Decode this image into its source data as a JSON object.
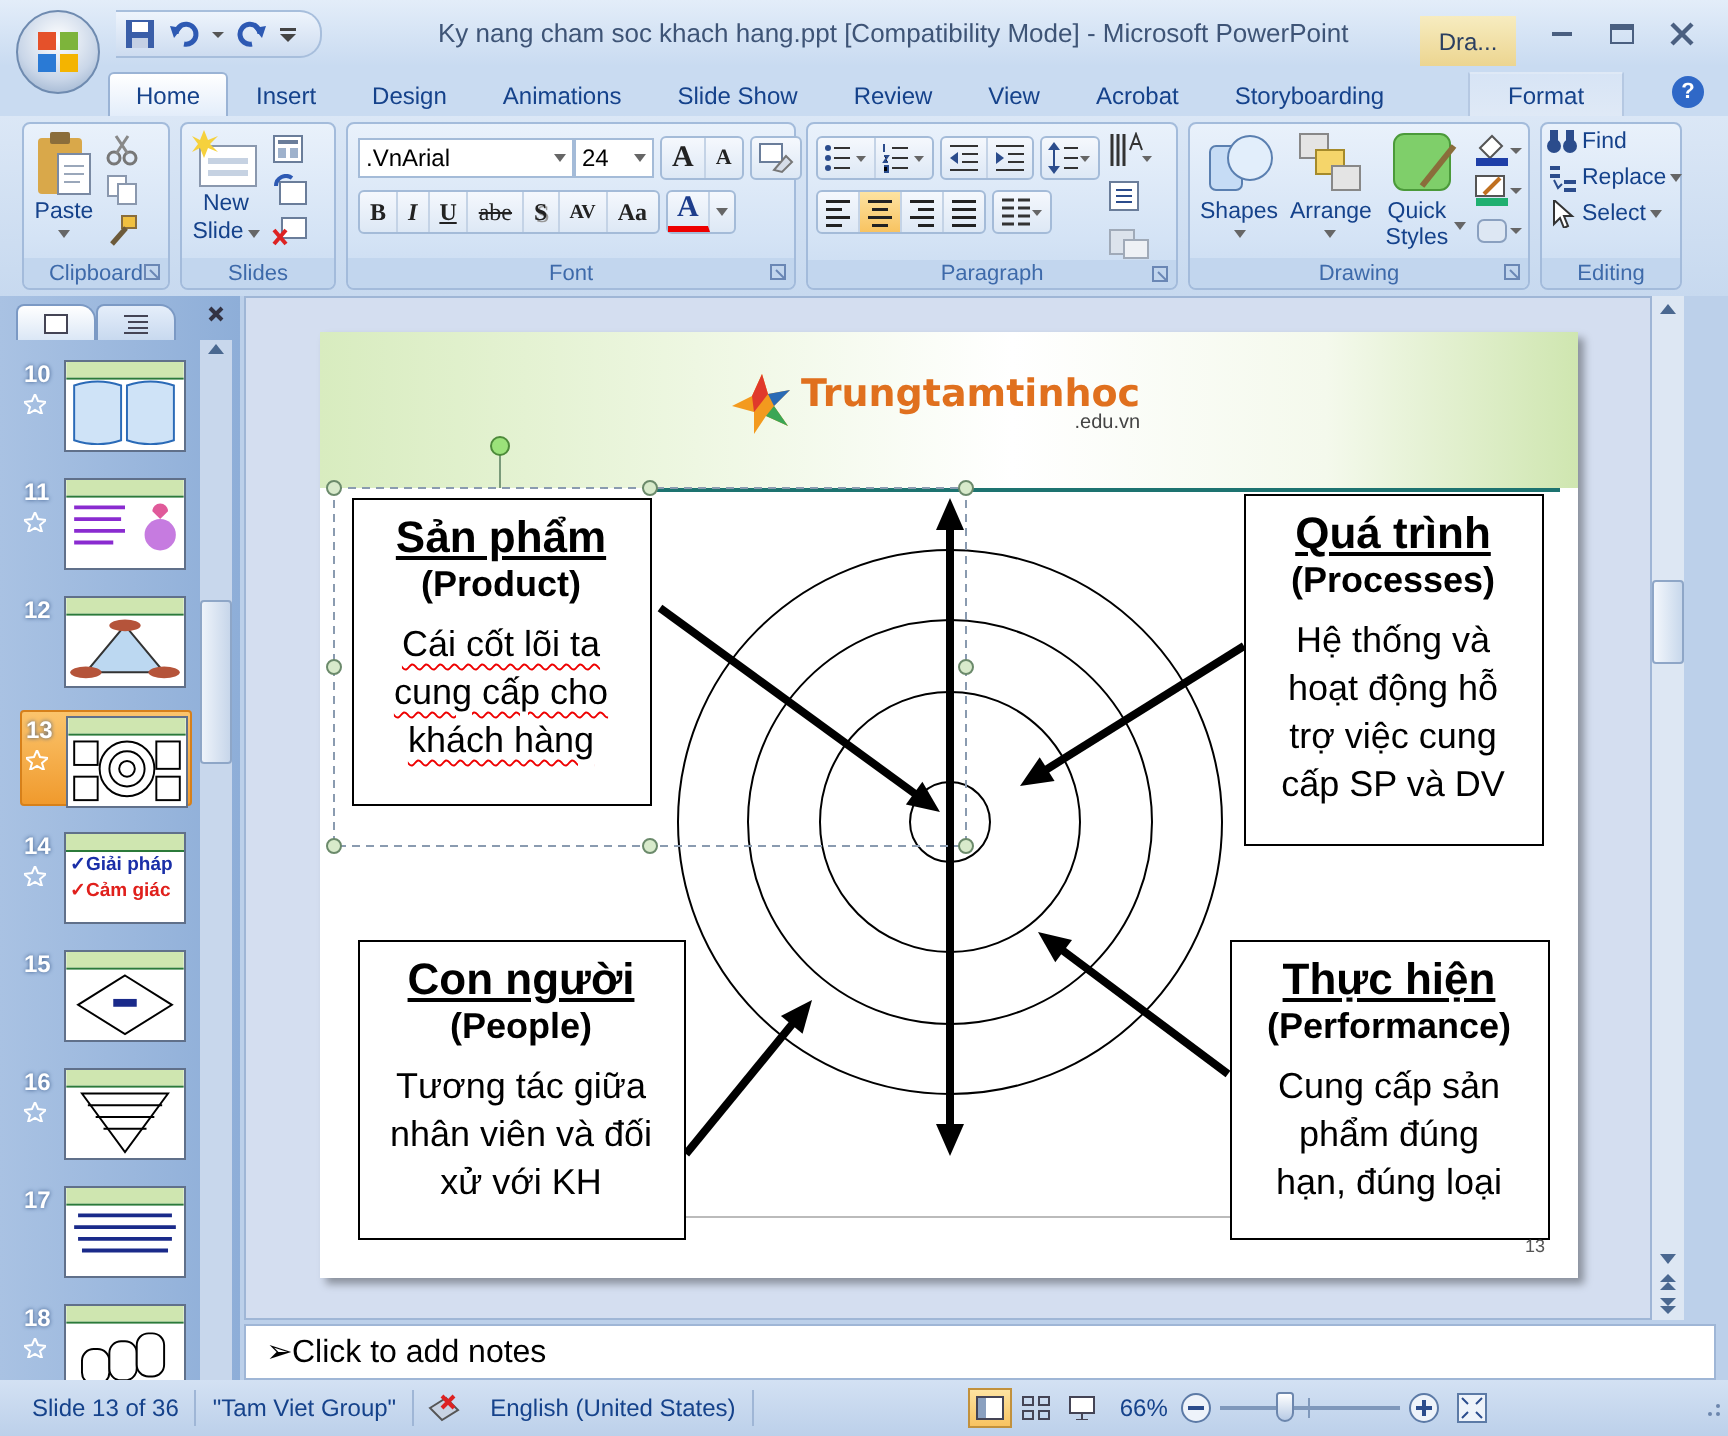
{
  "window": {
    "title": "Ky nang cham soc khach hang.ppt [Compatibility Mode] - Microsoft PowerPoint",
    "contextual_tab": "Dra...",
    "help": "?"
  },
  "ribbon_tabs": [
    {
      "label": "Home",
      "selected": true,
      "kind": "standard"
    },
    {
      "label": "Insert",
      "selected": false,
      "kind": "standard"
    },
    {
      "label": "Design",
      "selected": false,
      "kind": "standard"
    },
    {
      "label": "Animations",
      "selected": false,
      "kind": "standard"
    },
    {
      "label": "Slide Show",
      "selected": false,
      "kind": "standard"
    },
    {
      "label": "Review",
      "selected": false,
      "kind": "standard"
    },
    {
      "label": "View",
      "selected": false,
      "kind": "standard"
    },
    {
      "label": "Acrobat",
      "selected": false,
      "kind": "standard"
    },
    {
      "label": "Storyboarding",
      "selected": false,
      "kind": "standard"
    },
    {
      "label": "Format",
      "selected": false,
      "kind": "contextual"
    }
  ],
  "ribbon": {
    "clipboard": {
      "label": "Clipboard",
      "paste": "Paste"
    },
    "slides": {
      "label": "Slides",
      "new_slide": [
        "New",
        "Slide"
      ]
    },
    "font": {
      "label": "Font",
      "font_name": ".VnArial",
      "font_size": "24",
      "grow": "A",
      "shrink": "A",
      "format_buttons": [
        "B",
        "I",
        "U",
        "abe",
        "S",
        "AV",
        "Aa"
      ],
      "font_color": "A"
    },
    "paragraph": {
      "label": "Paragraph",
      "alignment_buttons": [
        {
          "selected": false
        },
        {
          "selected": true
        },
        {
          "selected": false
        },
        {
          "selected": false
        }
      ]
    },
    "drawing": {
      "label": "Drawing",
      "buttons": [
        "Shapes",
        "Arrange",
        "Quick Styles"
      ]
    },
    "editing": {
      "label": "Editing",
      "buttons": [
        "Find",
        "Replace",
        "Select"
      ]
    }
  },
  "slides_panel": {
    "slides": [
      {
        "number": "10",
        "animated": true,
        "selected": false,
        "kind": "boxes"
      },
      {
        "number": "11",
        "animated": true,
        "selected": false,
        "kind": "smiley"
      },
      {
        "number": "12",
        "animated": false,
        "selected": false,
        "kind": "triangle"
      },
      {
        "number": "13",
        "animated": true,
        "selected": true,
        "kind": "target"
      },
      {
        "number": "14",
        "animated": true,
        "selected": false,
        "kind": "text",
        "lines": [
          "✓Giải pháp",
          "✓Cảm giác"
        ]
      },
      {
        "number": "15",
        "animated": false,
        "selected": false,
        "kind": "diamond"
      },
      {
        "number": "16",
        "animated": true,
        "selected": false,
        "kind": "pyramid"
      },
      {
        "number": "17",
        "animated": false,
        "selected": false,
        "kind": "paragraph"
      },
      {
        "number": "18",
        "animated": true,
        "selected": false,
        "kind": "cylinders"
      }
    ]
  },
  "slide": {
    "logo": {
      "name": "Trungtamtinhoc",
      "domain": ".edu.vn"
    },
    "boxes": [
      {
        "title": "Sản phẩm",
        "subtitle": "(Product)",
        "body": "Cái cốt lõi ta cung cấp cho khách hàng",
        "selected": true,
        "spellcheck": true
      },
      {
        "title": "Quá trình",
        "subtitle": "(Processes)",
        "body": "Hệ thống và hoạt động hỗ trợ việc cung cấp SP và DV",
        "selected": false,
        "spellcheck": false
      },
      {
        "title": "Con người",
        "subtitle": "(People)",
        "body": "Tương tác giữa nhân viên và đối xử với KH",
        "selected": false,
        "spellcheck": false
      },
      {
        "title": "Thực hiện",
        "subtitle": "(Performance)",
        "body": "Cung cấp sản phẩm đúng hạn, đúng loại",
        "selected": false,
        "spellcheck": false
      }
    ],
    "number": "13"
  },
  "notes": {
    "placeholder": "➢Click to add notes"
  },
  "status_bar": {
    "slide_info": "Slide 13 of 36",
    "theme": "\"Tam Viet Group\"",
    "language": "English (United States)",
    "views": [
      {
        "selected": true
      },
      {
        "selected": false
      },
      {
        "selected": false
      }
    ],
    "zoom": "66%",
    "zoom_slider": {
      "level": 0.36
    }
  }
}
